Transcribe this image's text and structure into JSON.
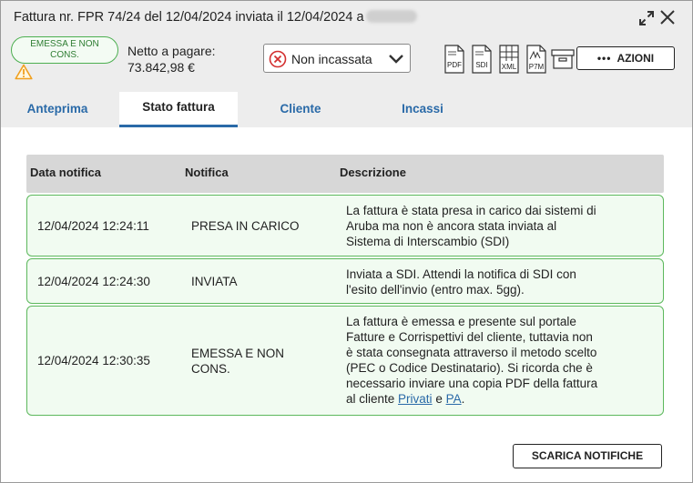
{
  "window": {
    "title": "Fattura nr. FPR 74/24 del 12/04/2024 inviata il 12/04/2024 a",
    "expand_icon": "expand-icon",
    "close_icon": "close-icon"
  },
  "invoice": {
    "status_badge_line1": "EMESSA E NON",
    "status_badge_line2": "CONS.",
    "status_badge_color": "#4caf50",
    "warning_icon": "warning-icon",
    "netto_label": "Netto a pagare:",
    "netto_value": "73.842,98 €"
  },
  "payment_state_select": {
    "selected": "Non incassata",
    "icon": "cross-circle-icon",
    "icon_color": "#d32f2f"
  },
  "file_buttons": [
    {
      "label": "PDF",
      "icon": "pdf-file-icon"
    },
    {
      "label": "SDI",
      "icon": "sdi-file-icon"
    },
    {
      "label": "XML",
      "icon": "xml-file-icon"
    },
    {
      "label": "P7M",
      "icon": "p7m-file-icon"
    },
    {
      "label": "",
      "icon": "archive-icon"
    }
  ],
  "azioni_button": {
    "dots": "•••",
    "label": "AZIONI"
  },
  "tabs": [
    {
      "label": "Anteprima",
      "active": false
    },
    {
      "label": "Stato fattura",
      "active": true
    },
    {
      "label": "Cliente",
      "active": false
    },
    {
      "label": "Incassi",
      "active": false
    }
  ],
  "table": {
    "headers": [
      "Data notifica",
      "Notifica",
      "Descrizione"
    ],
    "rows": [
      {
        "date": "12/04/2024 12:24:11",
        "notifica": "PRESA IN CARICO",
        "desc_lines": [
          "La fattura è stata presa in carico dai sistemi di",
          "Aruba ma non è ancora stata inviata al",
          "Sistema di Interscambio (SDI)"
        ]
      },
      {
        "date": "12/04/2024 12:24:30",
        "notifica": "INVIATA",
        "desc_lines": [
          "Inviata a SDI. Attendi la notifica di SDI con",
          "l'esito dell'invio (entro max. 5gg)."
        ]
      },
      {
        "date": "12/04/2024 12:30:35",
        "notifica_lines": [
          "EMESSA E NON",
          "CONS."
        ],
        "desc_lines": [
          "La fattura è emessa e presente sul portale",
          "Fatture e Corrispettivi del cliente, tuttavia non",
          "è stata consegnata attraverso il metodo scelto",
          "(PEC o Codice Destinatario). Si ricorda che è",
          "necessario inviare una copia PDF della fattura"
        ],
        "desc_last_prefix": "al cliente ",
        "link_privati": "Privati",
        "desc_and": " e ",
        "link_pa": "PA",
        "desc_end": "."
      }
    ]
  },
  "scarica_button": {
    "label": "SCARICA NOTIFICHE"
  },
  "colors": {
    "accent": "#2a6aa8",
    "row_border": "#5cb85c",
    "row_bg": "#f1fbf1",
    "header_bg": "#ededed"
  }
}
